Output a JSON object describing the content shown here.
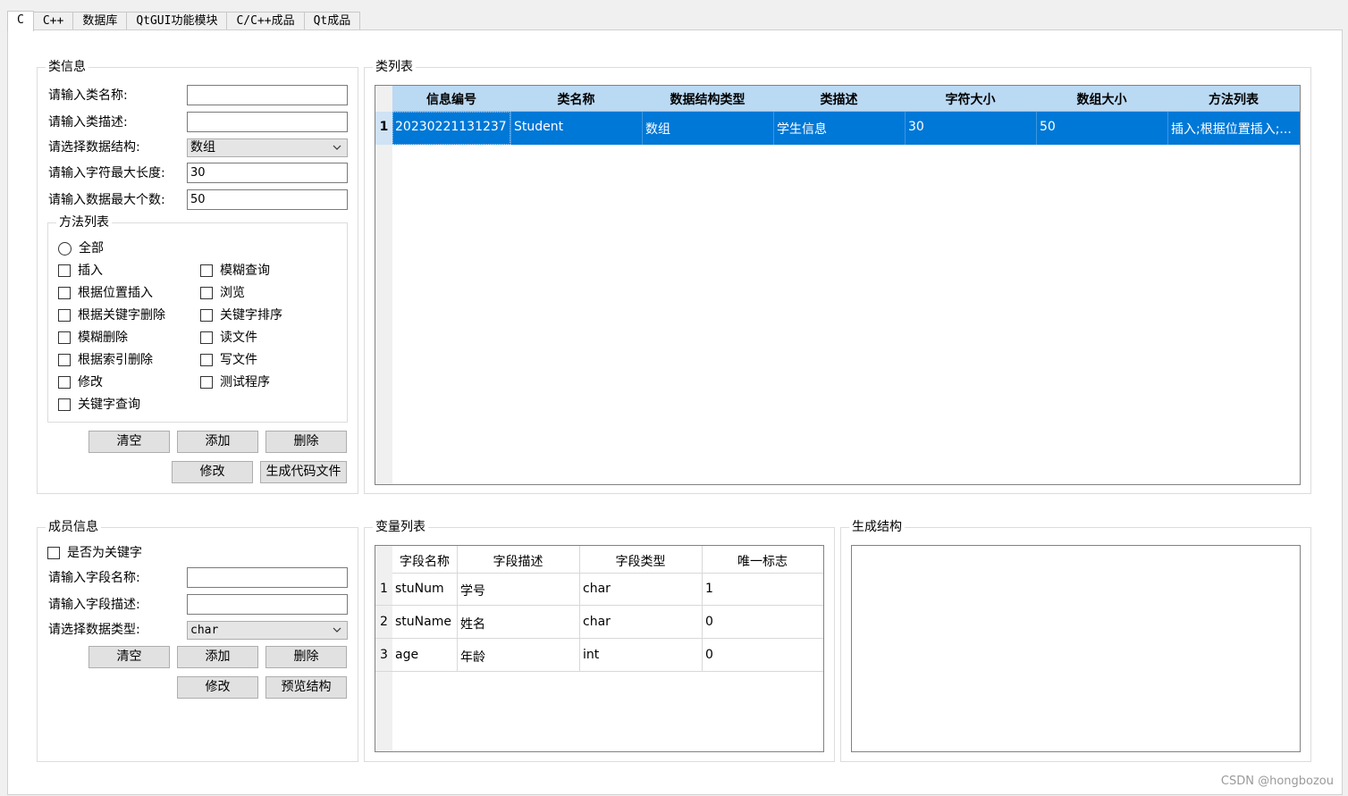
{
  "tabs": [
    "C",
    "C++",
    "数据库",
    "QtGUI功能模块",
    "C/C++成品",
    "Qt成品"
  ],
  "class_info": {
    "title": "类信息",
    "name_label": "请输入类名称:",
    "name_value": "",
    "desc_label": "请输入类描述:",
    "desc_value": "",
    "struct_label": "请选择数据结构:",
    "struct_value": "数组",
    "strlen_label": "请输入字符最大长度:",
    "strlen_value": "30",
    "count_label": "请输入数据最大个数:",
    "count_value": "50",
    "methods_title": "方法列表",
    "all_label": "全部",
    "methods_left": [
      "插入",
      "根据位置插入",
      "根据关键字删除",
      "模糊删除",
      "根据索引删除",
      "修改",
      "关键字查询"
    ],
    "methods_right": [
      "模糊查询",
      "浏览",
      "关键字排序",
      "读文件",
      "写文件",
      "测试程序"
    ],
    "buttons": {
      "clear": "清空",
      "add": "添加",
      "delete": "删除",
      "modify": "修改",
      "gen_code": "生成代码文件"
    }
  },
  "class_list": {
    "title": "类列表",
    "columns": [
      "信息编号",
      "类名称",
      "数据结构类型",
      "类描述",
      "字符大小",
      "数组大小",
      "方法列表"
    ],
    "rows": [
      {
        "index": "1",
        "cells": [
          "20230221131237",
          "Student",
          "数组",
          "学生信息",
          "30",
          "50",
          "插入;根据位置插入;..."
        ]
      }
    ]
  },
  "member_info": {
    "title": "成员信息",
    "is_key_label": "是否为关键字",
    "name_label": "请输入字段名称:",
    "name_value": "",
    "desc_label": "请输入字段描述:",
    "desc_value": "",
    "type_label": "请选择数据类型:",
    "type_value": "char",
    "buttons": {
      "clear": "清空",
      "add": "添加",
      "delete": "删除",
      "modify": "修改",
      "preview": "预览结构"
    }
  },
  "var_list": {
    "title": "变量列表",
    "columns": [
      "字段名称",
      "字段描述",
      "字段类型",
      "唯一标志"
    ],
    "rows": [
      {
        "index": "1",
        "cells": [
          "stuNum",
          "学号",
          "char",
          "1"
        ]
      },
      {
        "index": "2",
        "cells": [
          "stuName",
          "姓名",
          "char",
          "0"
        ]
      },
      {
        "index": "3",
        "cells": [
          "age",
          "年龄",
          "int",
          "0"
        ]
      }
    ]
  },
  "gen_struct": {
    "title": "生成结构",
    "content": ""
  },
  "watermark": "CSDN @hongbozou",
  "colors": {
    "selection": "#0078d7",
    "header_bg": "#bad9f3",
    "button_bg": "#e1e1e1"
  }
}
